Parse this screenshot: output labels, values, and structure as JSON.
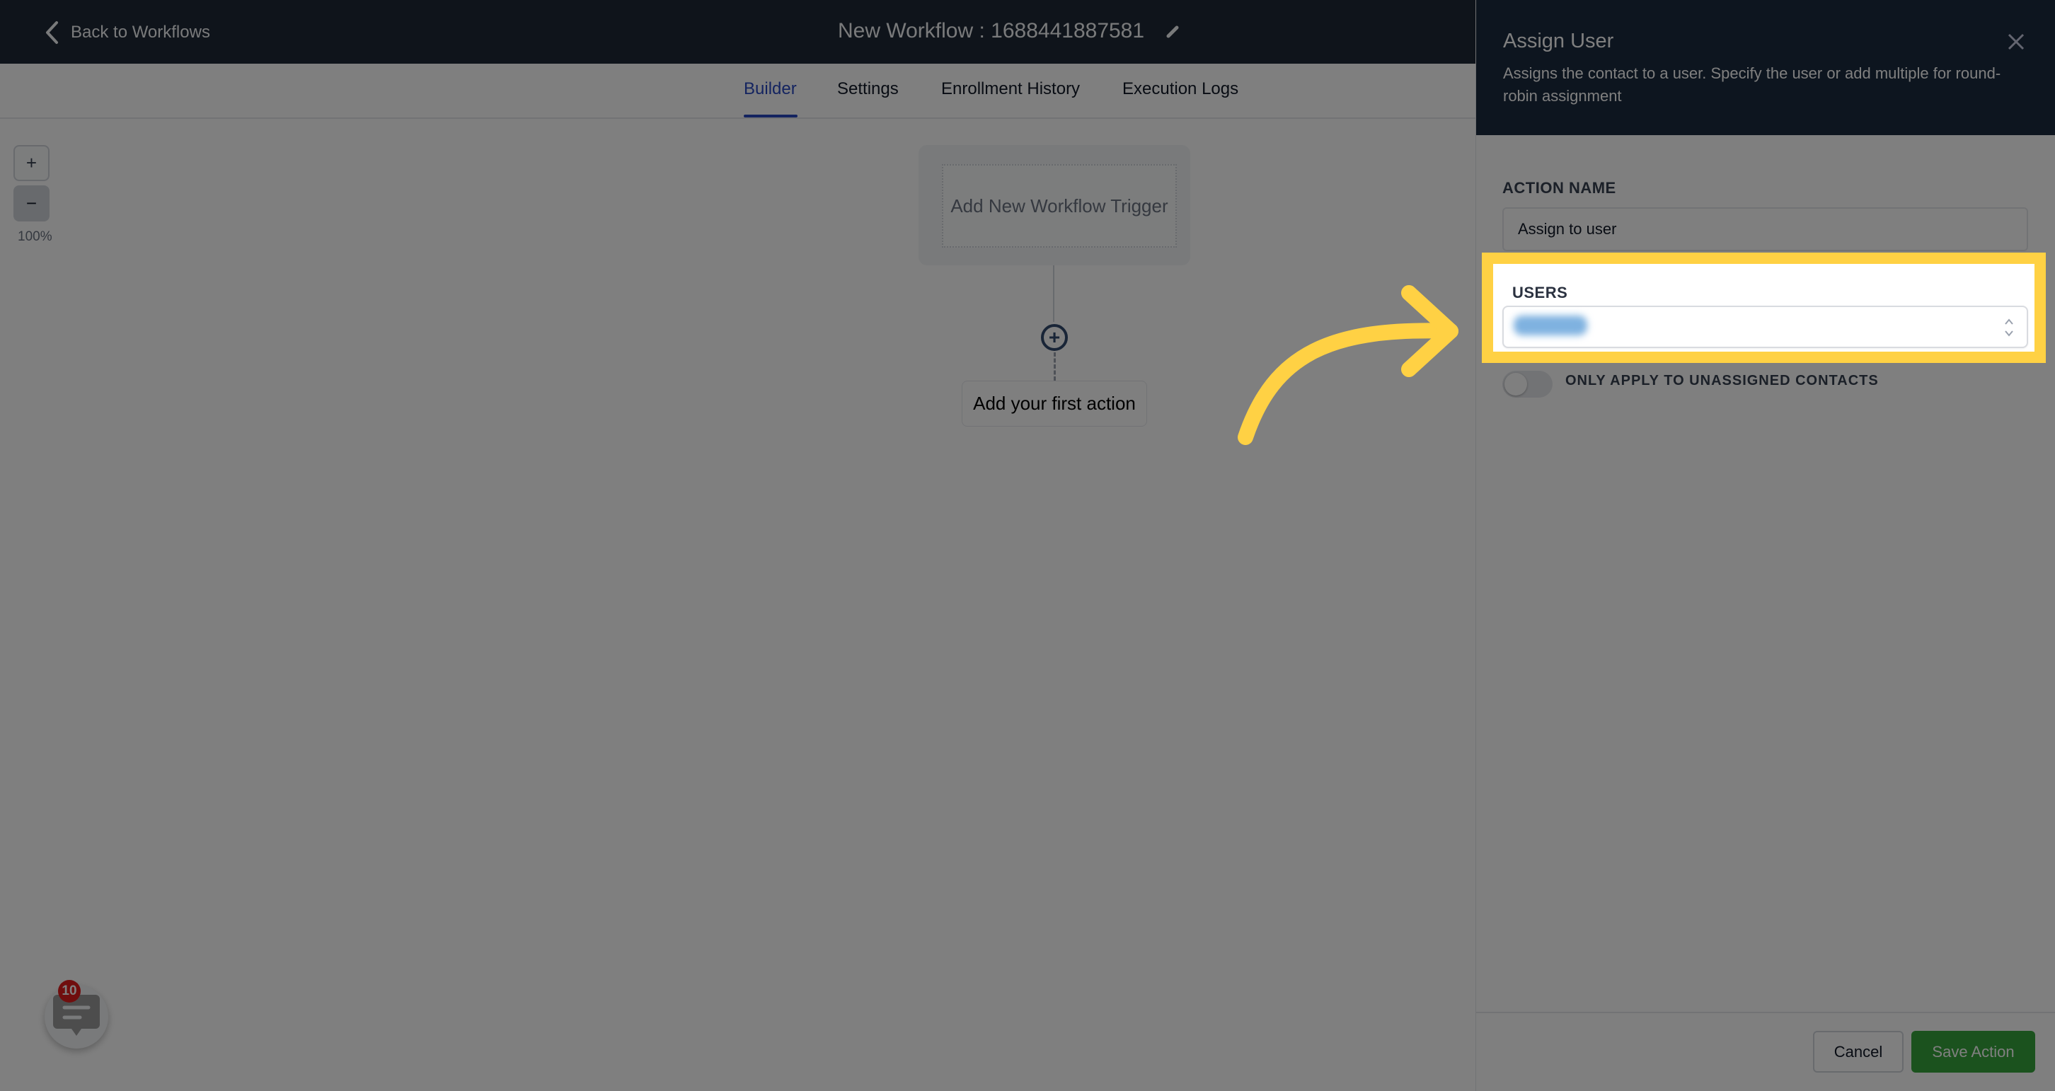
{
  "topbar": {
    "back_label": "Back to Workflows",
    "workflow_title": "New Workflow : 1688441887581"
  },
  "tabs": [
    {
      "label": "Builder",
      "active": true
    },
    {
      "label": "Settings",
      "active": false
    },
    {
      "label": "Enrollment History",
      "active": false
    },
    {
      "label": "Execution Logs",
      "active": false
    }
  ],
  "canvas": {
    "zoom_in": "+",
    "zoom_out": "−",
    "zoom_level": "100%",
    "trigger_label": "Add New Workflow Trigger",
    "add_action_symbol": "+",
    "first_action_label": "Add your first action"
  },
  "chat": {
    "badge_count": "10"
  },
  "drawer": {
    "title": "Assign User",
    "description": "Assigns the contact to a user. Specify the user or add multiple for round-robin assignment",
    "action_name_label": "ACTION NAME",
    "action_name_value": "Assign to user",
    "users_label": "USERS",
    "users_value": "(redacted user)",
    "toggle_label": "ONLY APPLY TO UNASSIGNED CONTACTS",
    "toggle_on": false,
    "cancel_label": "Cancel",
    "save_label": "Save Action"
  },
  "colors": {
    "accent_tab": "#2948c0",
    "save_button": "#37a53c",
    "highlight": "#ffd144",
    "badge": "#e11d1d"
  }
}
